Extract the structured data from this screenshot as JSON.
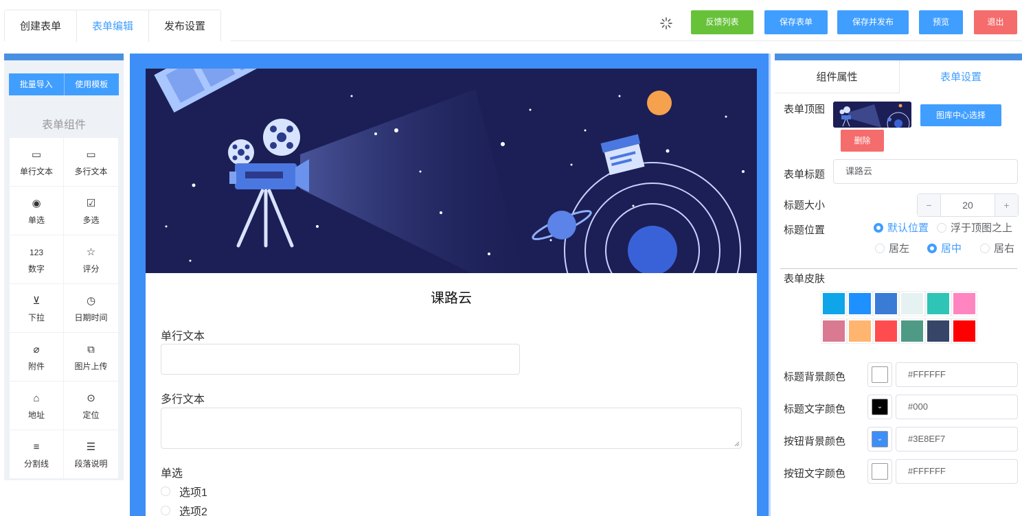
{
  "header": {
    "tabs": [
      {
        "label": "创建表单",
        "active": false
      },
      {
        "label": "表单编辑",
        "active": true
      },
      {
        "label": "发布设置",
        "active": false
      }
    ],
    "spinner_icon": "loading-icon",
    "buttons": {
      "feedback": "反馈列表",
      "save": "保存表单",
      "save_publish": "保存并发布",
      "preview": "预览",
      "exit": "退出"
    },
    "colors": {
      "green": "#67c23a",
      "blue": "#409eff",
      "red": "#f56c6c"
    }
  },
  "left_panel": {
    "import_label": "批量导入",
    "template_label": "使用模板",
    "section_title": "表单组件",
    "components": [
      {
        "label": "单行文本",
        "icon": "single-line-text-icon",
        "glyph": "▭"
      },
      {
        "label": "多行文本",
        "icon": "multi-line-text-icon",
        "glyph": "▭"
      },
      {
        "label": "单选",
        "icon": "radio-icon",
        "glyph": "◉"
      },
      {
        "label": "多选",
        "icon": "checkbox-icon",
        "glyph": "☑"
      },
      {
        "label": "数字",
        "icon": "number-icon",
        "glyph": "123"
      },
      {
        "label": "评分",
        "icon": "star-icon",
        "glyph": "☆"
      },
      {
        "label": "下拉",
        "icon": "dropdown-icon",
        "glyph": "⊻"
      },
      {
        "label": "日期时间",
        "icon": "datetime-icon",
        "glyph": "◷"
      },
      {
        "label": "附件",
        "icon": "paperclip-icon",
        "glyph": "⌀"
      },
      {
        "label": "图片上传",
        "icon": "image-upload-icon",
        "glyph": "⧉"
      },
      {
        "label": "地址",
        "icon": "address-icon",
        "glyph": "⌂"
      },
      {
        "label": "定位",
        "icon": "location-pin-icon",
        "glyph": "⊙"
      },
      {
        "label": "分割线",
        "icon": "divider-icon",
        "glyph": "≡"
      },
      {
        "label": "段落说明",
        "icon": "paragraph-icon",
        "glyph": "☰"
      }
    ]
  },
  "form_preview": {
    "title": "课路云",
    "fields": {
      "single_line_label": "单行文本",
      "multi_line_label": "多行文本",
      "radio_label": "单选",
      "radio_options": [
        "选项1",
        "选项2"
      ]
    }
  },
  "right_panel": {
    "tabs": [
      {
        "label": "组件属性",
        "active": false
      },
      {
        "label": "表单设置",
        "active": true
      }
    ],
    "cover_label": "表单顶图",
    "gallery_button": "图库中心选择",
    "delete_button": "删除",
    "title_label": "表单标题",
    "title_value": "课路云",
    "size_label": "标题大小",
    "size_value": "20",
    "size_minus": "−",
    "size_plus": "+",
    "position_label": "标题位置",
    "position_options": [
      {
        "label": "默认位置",
        "selected": true
      },
      {
        "label": "浮于顶图之上",
        "selected": false
      }
    ],
    "align_options": [
      {
        "label": "居左",
        "selected": false
      },
      {
        "label": "居中",
        "selected": true
      },
      {
        "label": "居右",
        "selected": false
      }
    ],
    "skin_label": "表单皮肤",
    "skins": [
      "#0ea5e9",
      "#1e90ff",
      "#3a7bd5",
      "#e6f2f2",
      "#2ec4b6",
      "#ff85c0",
      "#d97a92",
      "#ffb570",
      "#ff4d4f",
      "#4f9a85",
      "#374569",
      "#ff0000"
    ],
    "color_settings": [
      {
        "label": "标题背景颜色",
        "value": "#FFFFFF",
        "swatch": "#ffffff"
      },
      {
        "label": "标题文字颜色",
        "value": "#000",
        "swatch": "#000000"
      },
      {
        "label": "按钮背景颜色",
        "value": "#3E8EF7",
        "swatch": "#3e8ef7"
      },
      {
        "label": "按钮文字颜色",
        "value": "#FFFFFF",
        "swatch": "#ffffff"
      }
    ]
  }
}
